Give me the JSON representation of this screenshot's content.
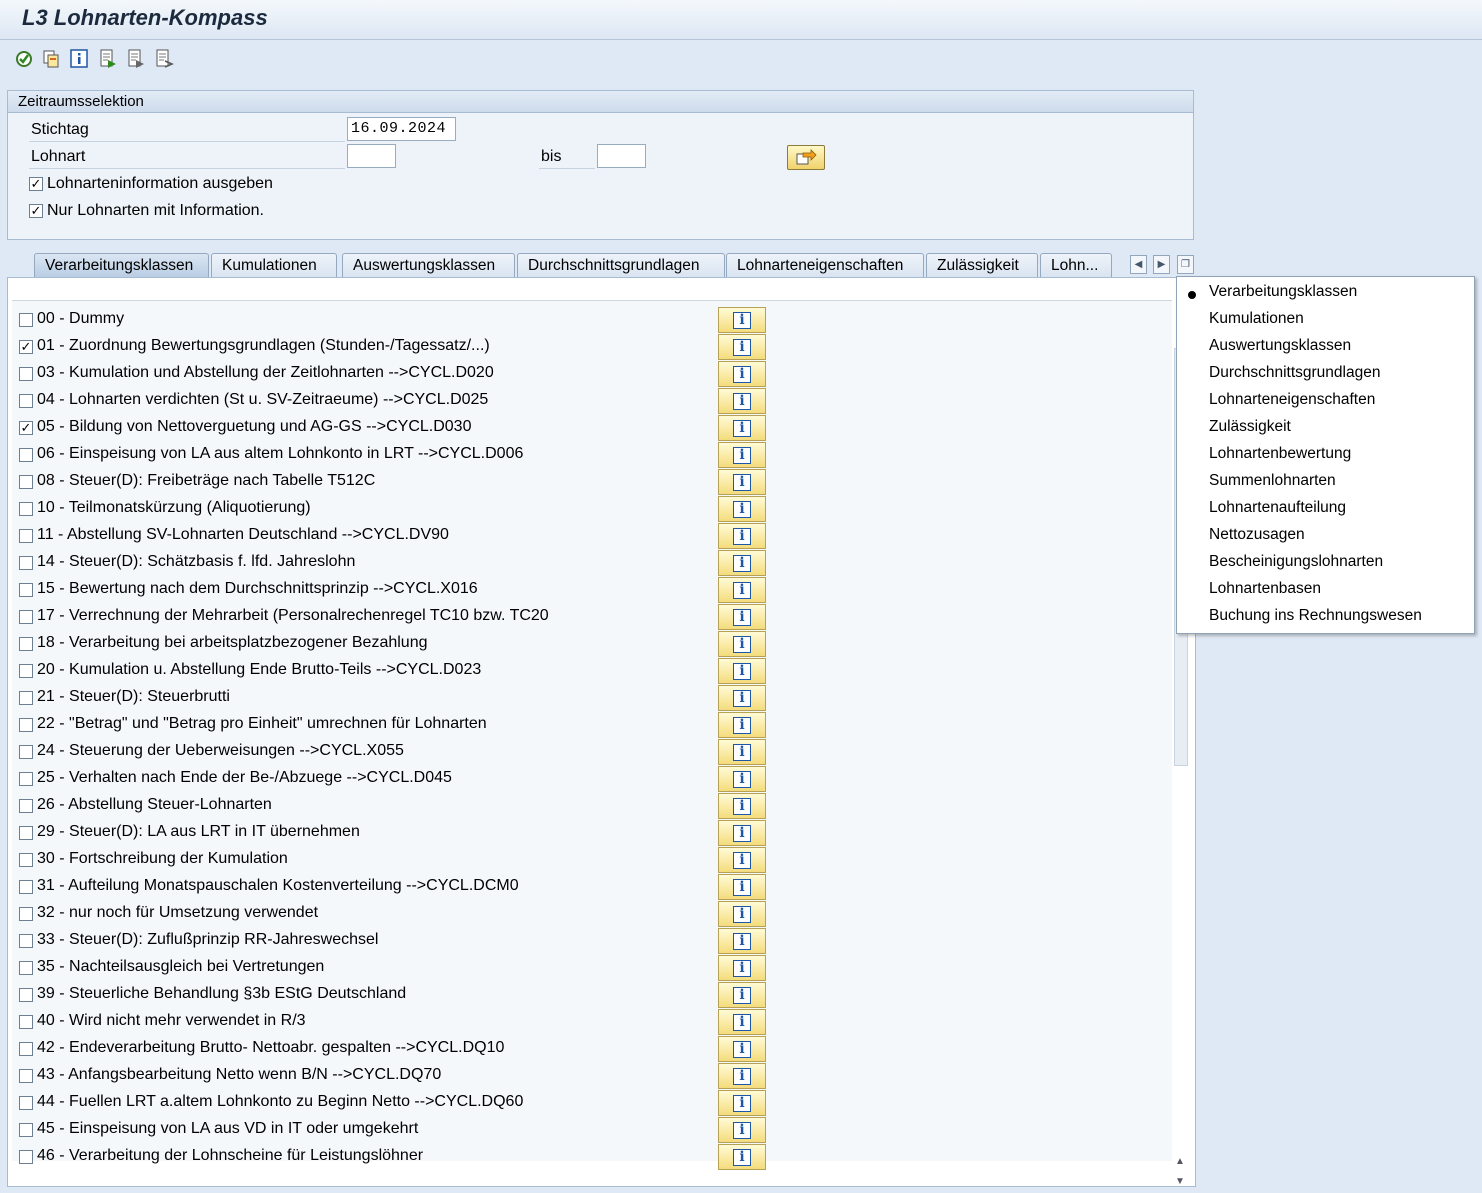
{
  "window": {
    "title": "L3 Lohnarten-Kompass"
  },
  "toolbar": {
    "icons": [
      "execute-icon",
      "copy-icon",
      "info-icon",
      "export-icon",
      "export-icon-2",
      "export-icon-3"
    ]
  },
  "selection": {
    "header": "Zeitraumsselektion",
    "stichtag_label": "Stichtag",
    "stichtag_value": "16.09.2024",
    "lohnart_label": "Lohnart",
    "lohnart_from": "",
    "bis_label": "bis",
    "lohnart_to": "",
    "option1_label": "Lohnarteninformation ausgeben",
    "option1_checked": true,
    "option2_label": "Nur Lohnarten mit Information.",
    "option2_checked": true
  },
  "tabs": [
    {
      "label": "Verarbeitungsklassen",
      "active": true
    },
    {
      "label": "Kumulationen",
      "active": false
    },
    {
      "label": "Auswertungsklassen",
      "active": false
    },
    {
      "label": "Durchschnittsgrundlagen",
      "active": false
    },
    {
      "label": "Lohnarteneigenschaften",
      "active": false
    },
    {
      "label": "Zulässigkeit",
      "active": false
    },
    {
      "label": "Lohn...",
      "active": false
    }
  ],
  "list": [
    {
      "label": "00 - Dummy",
      "checked": false
    },
    {
      "label": "01 - Zuordnung Bewertungsgrundlagen (Stunden-/Tagessatz/...)",
      "checked": true
    },
    {
      "label": "03 - Kumulation und Abstellung der Zeitlohnarten -->CYCL.D020",
      "checked": false
    },
    {
      "label": "04 - Lohnarten verdichten (St u. SV-Zeitraeume) -->CYCL.D025",
      "checked": false
    },
    {
      "label": "05 - Bildung von Nettoverguetung und AG-GS -->CYCL.D030",
      "checked": true
    },
    {
      "label": "06 - Einspeisung von LA aus altem Lohnkonto in LRT -->CYCL.D006",
      "checked": false
    },
    {
      "label": "08 - Steuer(D): Freibeträge nach Tabelle T512C",
      "checked": false
    },
    {
      "label": "10 - Teilmonatskürzung (Aliquotierung)",
      "checked": false
    },
    {
      "label": "11 - Abstellung SV-Lohnarten Deutschland -->CYCL.DV90",
      "checked": false
    },
    {
      "label": "14 - Steuer(D): Schätzbasis f. lfd. Jahreslohn",
      "checked": false
    },
    {
      "label": "15 - Bewertung nach dem Durchschnittsprinzip -->CYCL.X016",
      "checked": false
    },
    {
      "label": "17 - Verrechnung der Mehrarbeit (Personalrechenregel TC10 bzw. TC20",
      "checked": false
    },
    {
      "label": "18 - Verarbeitung bei arbeitsplatzbezogener Bezahlung",
      "checked": false
    },
    {
      "label": "20 - Kumulation u. Abstellung Ende Brutto-Teils -->CYCL.D023",
      "checked": false
    },
    {
      "label": "21 - Steuer(D): Steuerbrutti",
      "checked": false
    },
    {
      "label": "22 - \"Betrag\" und \"Betrag pro Einheit\" umrechnen für Lohnarten",
      "checked": false
    },
    {
      "label": "24 - Steuerung der Ueberweisungen -->CYCL.X055",
      "checked": false
    },
    {
      "label": "25 - Verhalten nach Ende der Be-/Abzuege -->CYCL.D045",
      "checked": false
    },
    {
      "label": "26 - Abstellung Steuer-Lohnarten",
      "checked": false
    },
    {
      "label": "29 - Steuer(D): LA aus LRT in IT übernehmen",
      "checked": false
    },
    {
      "label": "30 - Fortschreibung der Kumulation",
      "checked": false
    },
    {
      "label": "31 - Aufteilung Monatspauschalen Kostenverteilung -->CYCL.DCM0",
      "checked": false
    },
    {
      "label": "32 - nur noch für Umsetzung verwendet",
      "checked": false
    },
    {
      "label": "33 - Steuer(D): Zuflußprinzip RR-Jahreswechsel",
      "checked": false
    },
    {
      "label": "35 - Nachteilsausgleich bei Vertretungen",
      "checked": false
    },
    {
      "label": "39 - Steuerliche Behandlung §3b EStG Deutschland",
      "checked": false
    },
    {
      "label": "40 - Wird nicht mehr verwendet in R/3",
      "checked": false
    },
    {
      "label": "42 - Endeverarbeitung Brutto- Nettoabr. gespalten -->CYCL.DQ10",
      "checked": false
    },
    {
      "label": "43 - Anfangsbearbeitung Netto wenn B/N -->CYCL.DQ70",
      "checked": false
    },
    {
      "label": "44 - Fuellen LRT a.altem Lohnkonto zu Beginn Netto -->CYCL.DQ60",
      "checked": false
    },
    {
      "label": "45 - Einspeisung von LA aus VD in IT oder umgekehrt",
      "checked": false
    },
    {
      "label": "46 - Verarbeitung der Lohnscheine für Leistungslöhner",
      "checked": false
    }
  ],
  "info_button_glyph": "i",
  "tab_menu": [
    {
      "label": "Verarbeitungsklassen",
      "selected": true
    },
    {
      "label": "Kumulationen",
      "selected": false
    },
    {
      "label": "Auswertungsklassen",
      "selected": false
    },
    {
      "label": "Durchschnittsgrundlagen",
      "selected": false
    },
    {
      "label": "Lohnarteneigenschaften",
      "selected": false
    },
    {
      "label": "Zulässigkeit",
      "selected": false
    },
    {
      "label": "Lohnartenbewertung",
      "selected": false
    },
    {
      "label": "Summenlohnarten",
      "selected": false
    },
    {
      "label": "Lohnartenaufteilung",
      "selected": false
    },
    {
      "label": "Nettozusagen",
      "selected": false
    },
    {
      "label": "Bescheinigungslohnarten",
      "selected": false
    },
    {
      "label": "Lohnartenbasen",
      "selected": false
    },
    {
      "label": "Buchung ins Rechnungswesen",
      "selected": false
    }
  ],
  "colors": {
    "background": "#dfe9f5",
    "info_button": "#f4dc7c",
    "info_glyph": "#1d57a6"
  }
}
